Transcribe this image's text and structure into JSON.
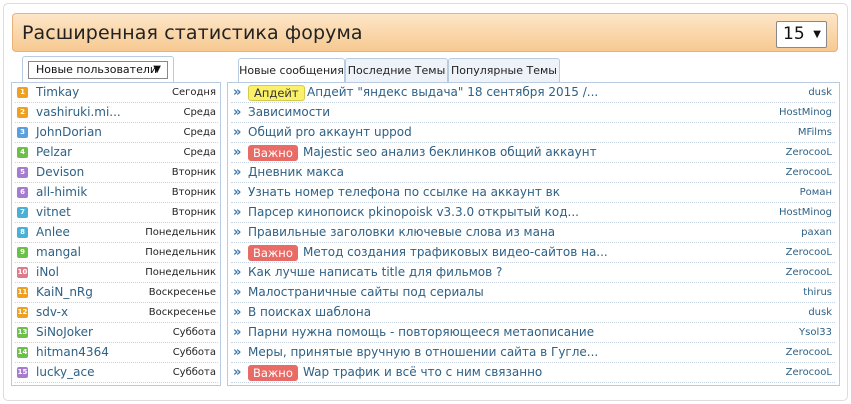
{
  "header": {
    "title": "Расширенная статистика форума",
    "count_value": "15",
    "arrow": "▼"
  },
  "left_panel": {
    "select_label": "Новые пользователи",
    "users": [
      {
        "rank": "1",
        "color": "#f0a020",
        "name": "Timkay",
        "day": "Сегодня"
      },
      {
        "rank": "2",
        "color": "#f0a020",
        "name": "vashiruki.mi...",
        "day": "Среда"
      },
      {
        "rank": "3",
        "color": "#5aa0e0",
        "name": "JohnDorian",
        "day": "Среда"
      },
      {
        "rank": "4",
        "color": "#6cc04a",
        "name": "Pelzar",
        "day": "Среда"
      },
      {
        "rank": "5",
        "color": "#a77cd0",
        "name": "Devison",
        "day": "Вторник"
      },
      {
        "rank": "6",
        "color": "#a77cd0",
        "name": "all-himik",
        "day": "Вторник"
      },
      {
        "rank": "7",
        "color": "#4ab0d8",
        "name": "vitnet",
        "day": "Вторник"
      },
      {
        "rank": "8",
        "color": "#4ab0d8",
        "name": "Anlee",
        "day": "Понедельник"
      },
      {
        "rank": "9",
        "color": "#6cc04a",
        "name": "mangal",
        "day": "Понедельник"
      },
      {
        "rank": "10",
        "color": "#e07a8a",
        "name": "iNol",
        "day": "Понедельник"
      },
      {
        "rank": "11",
        "color": "#f0a020",
        "name": "KaiN_nRg",
        "day": "Воскресенье"
      },
      {
        "rank": "12",
        "color": "#f0a020",
        "name": "sdv-x",
        "day": "Воскресенье"
      },
      {
        "rank": "13",
        "color": "#6cc04a",
        "name": "SiNoJoker",
        "day": "Суббота"
      },
      {
        "rank": "14",
        "color": "#6cc04a",
        "name": "hitman4364",
        "day": "Суббота"
      },
      {
        "rank": "15",
        "color": "#a77cd0",
        "name": "lucky_ace",
        "day": "Суббота"
      }
    ]
  },
  "tabs": [
    "Новые сообщения",
    "Последние Темы",
    "Популярные Темы"
  ],
  "topics": [
    {
      "badge": "Апдейт",
      "badge_type": "update",
      "title": "Апдейт \"яндекс выдача\" 18 сентября 2015 /...",
      "author": "dusk"
    },
    {
      "badge": "",
      "badge_type": "",
      "title": "Зависимости",
      "author": "HostMinog"
    },
    {
      "badge": "",
      "badge_type": "",
      "title": "Общий pro аккаунт uppod",
      "author": "MFilms"
    },
    {
      "badge": "Важно",
      "badge_type": "important",
      "title": "Majestic seo анализ беклинков общий аккаунт",
      "author": "ZerocooL"
    },
    {
      "badge": "",
      "badge_type": "",
      "title": "Дневник макса",
      "author": "ZerocooL"
    },
    {
      "badge": "",
      "badge_type": "",
      "title": "Узнать номер телефона по ссылке на аккаунт вк",
      "author": "Роман"
    },
    {
      "badge": "",
      "badge_type": "",
      "title": "Парсер кинопоиск pkinopoisk v3.3.0 открытый код...",
      "author": "HostMinog"
    },
    {
      "badge": "",
      "badge_type": "",
      "title": "Правильные заголовки ключевые слова из мана",
      "author": "paxan"
    },
    {
      "badge": "Важно",
      "badge_type": "important",
      "title": "Метод создания трафиковых видео-сайтов на...",
      "author": "ZerocooL"
    },
    {
      "badge": "",
      "badge_type": "",
      "title": "Как лучше написать title для фильмов ?",
      "author": "ZerocooL"
    },
    {
      "badge": "",
      "badge_type": "",
      "title": "Малостраничные сайты под сериалы",
      "author": "thirus"
    },
    {
      "badge": "",
      "badge_type": "",
      "title": "В поисках шаблона",
      "author": "dusk"
    },
    {
      "badge": "",
      "badge_type": "",
      "title": "Парни нужна помощь - повторяющееся метаописание",
      "author": "Ysol33"
    },
    {
      "badge": "",
      "badge_type": "",
      "title": "Меры, принятые вручную в отношении сайта в Гугле...",
      "author": "ZerocooL"
    },
    {
      "badge": "Важно",
      "badge_type": "important",
      "title": "Wap трафик и всё что с ним связанно",
      "author": "ZerocooL"
    }
  ],
  "icons": {
    "topic_arrow": "»"
  }
}
